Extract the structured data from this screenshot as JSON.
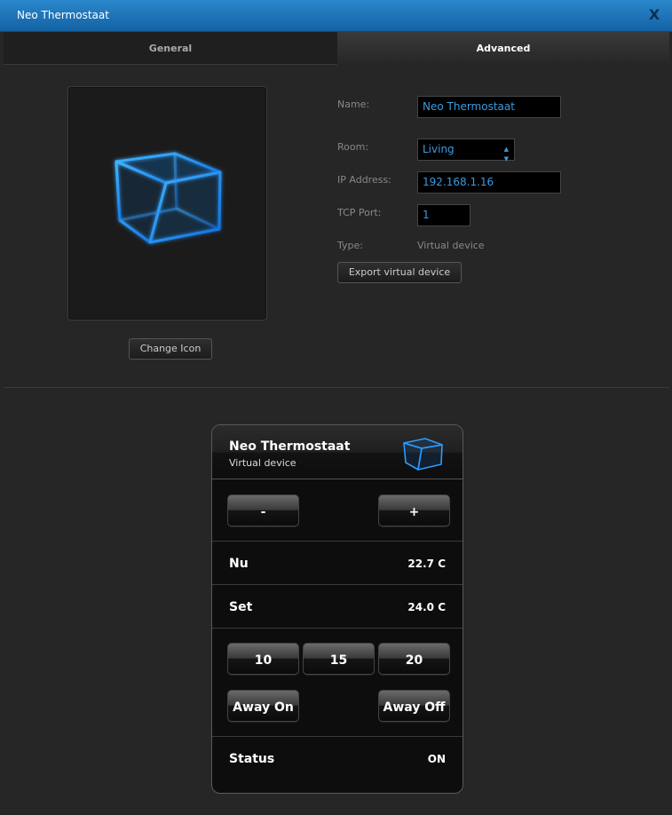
{
  "window": {
    "title": "Neo Thermostaat",
    "close_label": "X"
  },
  "tabs": [
    {
      "label": "General",
      "active": false
    },
    {
      "label": "Advanced",
      "active": true
    }
  ],
  "icon_panel": {
    "icon": "cube-icon",
    "change_label": "Change Icon"
  },
  "form": {
    "name_label": "Name:",
    "name_value": "Neo Thermostaat",
    "room_label": "Room:",
    "room_value": "Living",
    "ip_label": "IP Address:",
    "ip_value": "192.168.1.16",
    "port_label": "TCP Port:",
    "port_value": "1",
    "type_label": "Type:",
    "type_value": "Virtual device",
    "export_label": "Export virtual device"
  },
  "preview": {
    "title": "Neo Thermostaat",
    "subtitle": "Virtual device",
    "minus_label": "-",
    "plus_label": "+",
    "rows": [
      {
        "label": "Nu",
        "value": "22.7 C"
      },
      {
        "label": "Set",
        "value": "24.0 C"
      }
    ],
    "presets": [
      "10",
      "15",
      "20"
    ],
    "away_on_label": "Away On",
    "away_off_label": "Away Off",
    "status_label": "Status",
    "status_value": "ON"
  },
  "colors": {
    "titlebar": "#1e74ba",
    "accent": "#3b9be0",
    "cube": "#1e9bff"
  }
}
